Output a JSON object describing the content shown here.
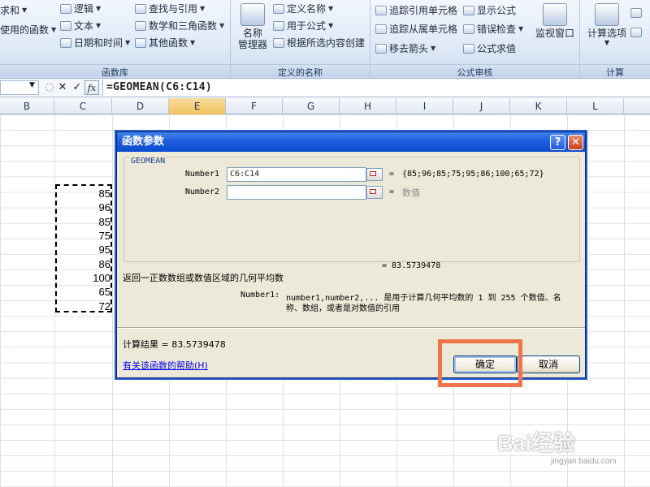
{
  "ribbon": {
    "formula_library": {
      "sum_label": "求和",
      "recent_label": "使用的函数",
      "logical": "逻辑",
      "text": "文本",
      "datetime": "日期和时间",
      "lookup": "查找与引用",
      "math": "数学和三角函数",
      "other": "其他函数",
      "group_label": "函数库"
    },
    "defined_names": {
      "name_manager": "名称\n管理器",
      "define_name": "定义名称",
      "use_in_formula": "用于公式",
      "create_from_selection": "根据所选内容创建",
      "group_label": "定义的名称"
    },
    "formula_auditing": {
      "trace_precedents": "追踪引用单元格",
      "trace_dependents": "追踪从属单元格",
      "remove_arrows": "移去箭头",
      "show_formulas": "显示公式",
      "error_checking": "错误检查",
      "evaluate_formula": "公式求值",
      "watch_window": "监视窗口",
      "group_label": "公式审核"
    },
    "calculation": {
      "calc_options": "计算选项",
      "group_label": "计算"
    }
  },
  "formula_bar": {
    "formula": "=GEOMEAN(C6:C14)",
    "fx": "fx"
  },
  "columns": [
    "B",
    "C",
    "D",
    "E",
    "F",
    "G",
    "H",
    "I",
    "J",
    "K",
    "L"
  ],
  "selected_column": "E",
  "cells": [
    "85",
    "96",
    "85",
    "75",
    "95",
    "86",
    "100",
    "65",
    "72"
  ],
  "dialog": {
    "title": "函数参数",
    "function_name": "GEOMEAN",
    "args": [
      {
        "label": "Number1",
        "value": "C6:C14",
        "result": "{85;96;85;75;95;86;100;65;72}"
      },
      {
        "label": "Number2",
        "value": "",
        "result": "数值"
      }
    ],
    "formula_result_line": "= 83.5739478",
    "description": "返回一正数数组或数值区域的几何平均数",
    "arg_help_label": "Number1:",
    "arg_help_text_1": "number1,number2,... 是用于计算几何平均数的 1 到 255 个数值、名",
    "arg_help_text_2": "称、数组，或者是对数值的引用",
    "calc_result": "计算结果 = 83.5739478",
    "help_link": "有关该函数的帮助(H)",
    "ok_label": "确定",
    "cancel_label": "取消"
  },
  "watermark": {
    "brand": "Bai经验",
    "url": "jingyan.baidu.com"
  }
}
